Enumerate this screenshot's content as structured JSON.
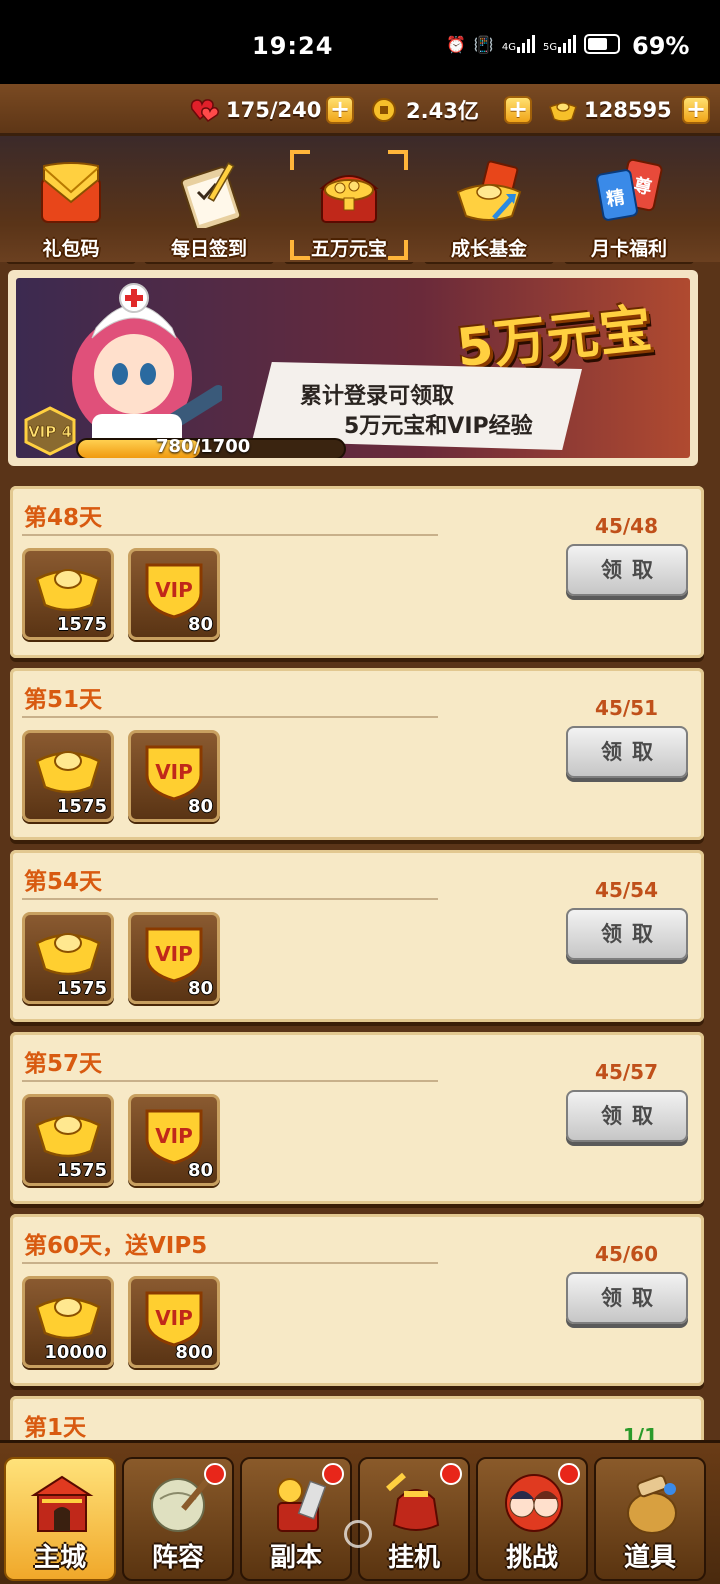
{
  "status_bar": {
    "time": "19:24",
    "network_1": "4G",
    "network_2": "5G",
    "battery_percent": "69%",
    "battery_level": 0.69
  },
  "resources": {
    "stamina": "175/240",
    "coins": "2.43亿",
    "ingots": "128595"
  },
  "tabs": [
    {
      "label": "礼包码",
      "icon": "gift-envelope-icon"
    },
    {
      "label": "每日签到",
      "icon": "daily-checkin-clipboard-icon"
    },
    {
      "label": "五万元宝",
      "icon": "treasure-chest-icon",
      "selected": true
    },
    {
      "label": "成长基金",
      "icon": "growth-fund-ingot-icon"
    },
    {
      "label": "月卡福利",
      "icon": "monthly-card-icon"
    }
  ],
  "banner": {
    "title": "5万元宝",
    "desc_line1": "累计登录可领取",
    "desc_line2": "5万元宝和VIP经验",
    "vip_badge": "VIP 4",
    "progress_text": "780/1700",
    "progress_fraction": 0.4588
  },
  "tasks": [
    {
      "day": "第48天",
      "progress": "45/48",
      "button": "领取",
      "rewards": [
        {
          "type": "gold-ingot",
          "qty": "1575"
        },
        {
          "type": "vip-exp",
          "qty": "80"
        }
      ]
    },
    {
      "day": "第51天",
      "progress": "45/51",
      "button": "领取",
      "rewards": [
        {
          "type": "gold-ingot",
          "qty": "1575"
        },
        {
          "type": "vip-exp",
          "qty": "80"
        }
      ]
    },
    {
      "day": "第54天",
      "progress": "45/54",
      "button": "领取",
      "rewards": [
        {
          "type": "gold-ingot",
          "qty": "1575"
        },
        {
          "type": "vip-exp",
          "qty": "80"
        }
      ]
    },
    {
      "day": "第57天",
      "progress": "45/57",
      "button": "领取",
      "rewards": [
        {
          "type": "gold-ingot",
          "qty": "1575"
        },
        {
          "type": "vip-exp",
          "qty": "80"
        }
      ]
    },
    {
      "day": "第60天，送VIP5",
      "progress": "45/60",
      "button": "领取",
      "rewards": [
        {
          "type": "gold-ingot",
          "qty": "10000"
        },
        {
          "type": "vip-exp",
          "qty": "800"
        }
      ]
    },
    {
      "day": "第1天",
      "progress": "1/1",
      "button": "",
      "rewards": []
    }
  ],
  "nav": [
    {
      "label": "主城",
      "icon": "main-city-gate-icon",
      "selected": true,
      "badge": false
    },
    {
      "label": "阵容",
      "icon": "lineup-fan-icon",
      "badge": true
    },
    {
      "label": "副本",
      "icon": "dungeon-icon",
      "badge": true
    },
    {
      "label": "挂机",
      "icon": "idle-pouch-icon",
      "badge": true
    },
    {
      "label": "挑战",
      "icon": "challenge-icon",
      "badge": true
    },
    {
      "label": "道具",
      "icon": "items-pot-icon",
      "badge": false
    }
  ],
  "colors": {
    "accent_orange": "#d85a10",
    "progress_red": "#c0501a",
    "card_bg": "#f7e9c6",
    "wood": "#5a3418",
    "gold": "#ffd040"
  }
}
